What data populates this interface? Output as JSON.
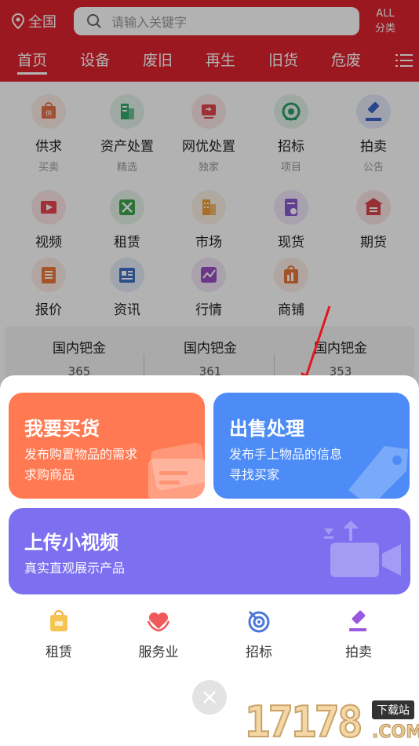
{
  "header": {
    "location": "全国",
    "search_placeholder": "请输入关键字",
    "all_line1": "ALL",
    "all_line2": "分类",
    "tabs": [
      "首页",
      "设备",
      "废旧",
      "再生",
      "旧货",
      "危废"
    ]
  },
  "grid": [
    {
      "label": "供求",
      "sub": "买卖",
      "icon": "supply-demand-icon",
      "color": "#e8734a"
    },
    {
      "label": "资产处置",
      "sub": "精选",
      "icon": "asset-disposal-icon",
      "color": "#36a86b"
    },
    {
      "label": "网优处置",
      "sub": "独家",
      "icon": "network-disposal-icon",
      "color": "#e0474f"
    },
    {
      "label": "招标",
      "sub": "项目",
      "icon": "tender-icon",
      "color": "#2e9c6a"
    },
    {
      "label": "拍卖",
      "sub": "公告",
      "icon": "auction-gavel-icon",
      "color": "#3b64c8"
    },
    {
      "label": "视频",
      "sub": "",
      "icon": "video-icon",
      "color": "#e8474f"
    },
    {
      "label": "租赁",
      "sub": "",
      "icon": "rental-tools-icon",
      "color": "#3da64f"
    },
    {
      "label": "市场",
      "sub": "",
      "icon": "market-building-icon",
      "color": "#f0a03a"
    },
    {
      "label": "现货",
      "sub": "",
      "icon": "spot-goods-icon",
      "color": "#8a5ad0"
    },
    {
      "label": "期货",
      "sub": "",
      "icon": "futures-icon",
      "color": "#d8444c"
    },
    {
      "label": "报价",
      "sub": "",
      "icon": "quote-icon",
      "color": "#ef7a3a"
    },
    {
      "label": "资讯",
      "sub": "",
      "icon": "news-icon",
      "color": "#3f72c8"
    },
    {
      "label": "行情",
      "sub": "",
      "icon": "market-trend-icon",
      "color": "#9a4fc4"
    },
    {
      "label": "商铺",
      "sub": "",
      "icon": "shop-icon",
      "color": "#e5783a"
    }
  ],
  "prices": [
    {
      "name": "国内钯金",
      "value": "365"
    },
    {
      "name": "国内钯金",
      "value": "361"
    },
    {
      "name": "国内钯金",
      "value": "353"
    }
  ],
  "sheet": {
    "buy": {
      "title": "我要买货",
      "desc1": "发布购置物品的需求",
      "desc2": "求购商品",
      "color": "#ff7a52"
    },
    "sell": {
      "title": "出售处理",
      "desc1": "发布手上物品的信息",
      "desc2": "寻找买家",
      "color": "#4d8cf7"
    },
    "video": {
      "title": "上传小视频",
      "desc1": "真实直观展示产品",
      "color": "#7d70f0"
    },
    "shortcuts": [
      {
        "label": "租赁",
        "icon": "rental-bag-icon"
      },
      {
        "label": "服务业",
        "icon": "service-heart-icon"
      },
      {
        "label": "招标",
        "icon": "tender-target-icon"
      },
      {
        "label": "拍卖",
        "icon": "auction-icon"
      }
    ]
  },
  "watermark": {
    "number": "17178",
    "badge": "下载站",
    "domain": ".COM"
  }
}
